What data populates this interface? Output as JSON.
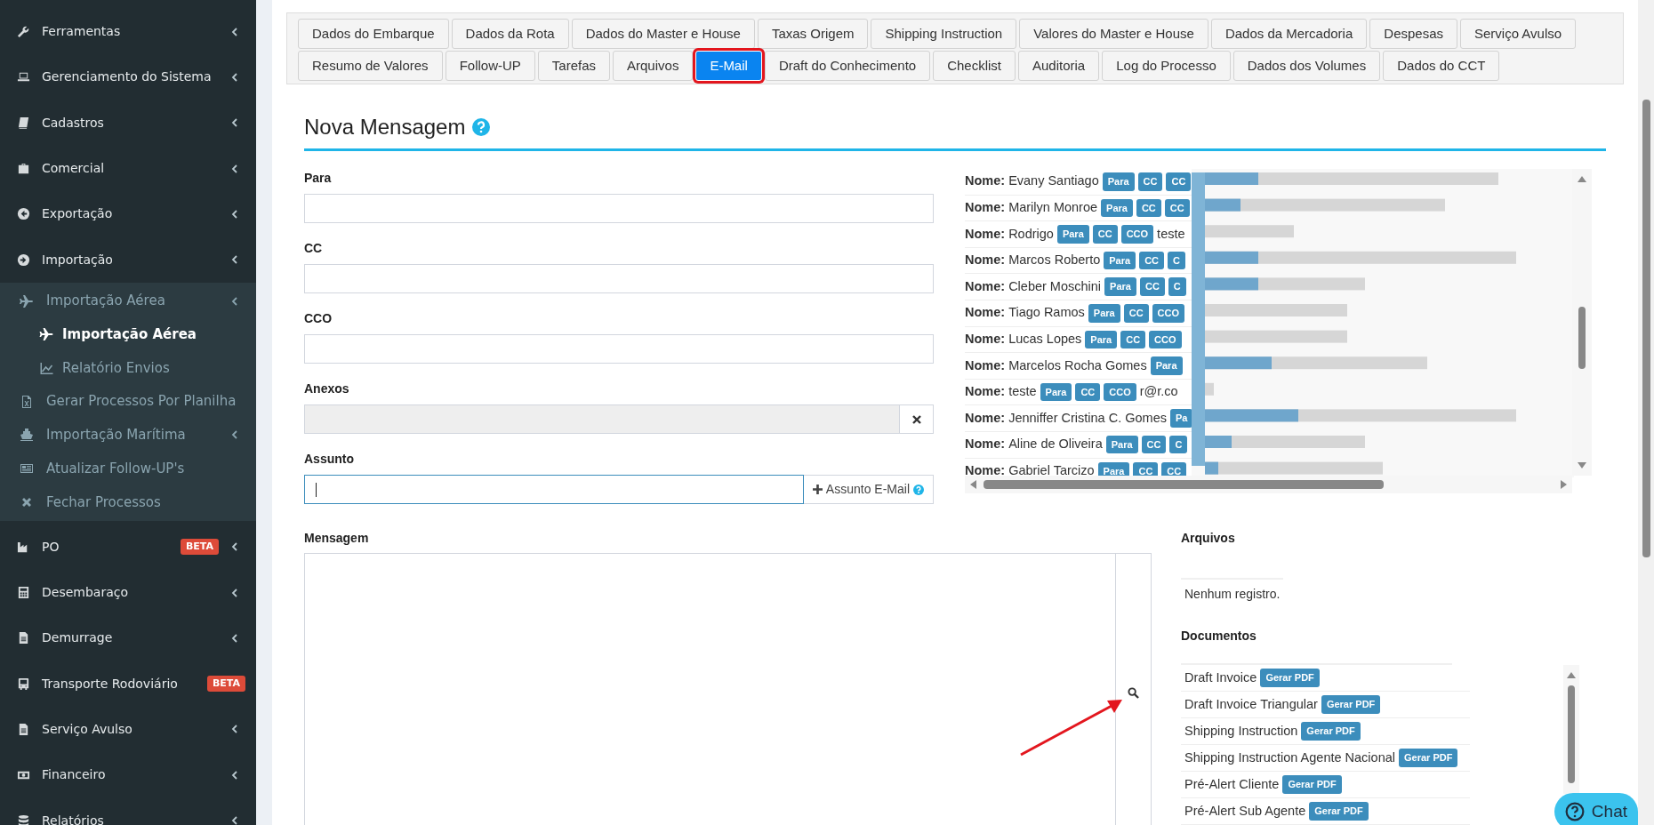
{
  "sidebar": {
    "items": [
      {
        "label": "Ferramentas",
        "caret": true
      },
      {
        "label": "Gerenciamento do Sistema",
        "caret": true
      },
      {
        "label": "Cadastros",
        "caret": true
      },
      {
        "label": "Comercial",
        "caret": true
      },
      {
        "label": "Exportação",
        "caret": true
      },
      {
        "label": "Importação",
        "caret": true,
        "expanded": true,
        "children": [
          {
            "label": "Importação Aérea",
            "caret": true,
            "selected": false,
            "children": [
              {
                "label": "Importação Aérea",
                "selected": true
              },
              {
                "label": "Relatório Envios",
                "selected": false
              }
            ]
          },
          {
            "label": "Gerar Processos Por Planilha",
            "caret": false,
            "selected": false
          },
          {
            "label": "Importação Marítima",
            "caret": true,
            "selected": false
          },
          {
            "label": "Atualizar Follow-UP's",
            "caret": false,
            "selected": false
          },
          {
            "label": "Fechar Processos",
            "caret": false,
            "selected": false
          }
        ]
      },
      {
        "label": "PO",
        "caret": true,
        "badge": "BETA"
      },
      {
        "label": "Desembaraço",
        "caret": true
      },
      {
        "label": "Demurrage",
        "caret": true
      },
      {
        "label": "Transporte Rodoviário",
        "caret": false,
        "badge": "BETA"
      },
      {
        "label": "Serviço Avulso",
        "caret": true
      },
      {
        "label": "Financeiro",
        "caret": true
      },
      {
        "label": "Relatórios",
        "caret": true
      }
    ]
  },
  "tab_rows": [
    [
      {
        "label": "Dados do Embarque",
        "selected": false
      },
      {
        "label": "Dados da Rota",
        "selected": false
      },
      {
        "label": "Dados do Master e House",
        "selected": false
      },
      {
        "label": "Taxas Origem",
        "selected": false
      },
      {
        "label": "Shipping Instruction",
        "selected": false
      },
      {
        "label": "Valores do Master e House",
        "selected": false
      },
      {
        "label": "Dados da Mercadoria",
        "selected": false
      },
      {
        "label": "Despesas",
        "selected": false
      },
      {
        "label": "Serviço Avulso",
        "selected": false
      }
    ],
    [
      {
        "label": "Resumo de Valores",
        "selected": false
      },
      {
        "label": "Follow-UP",
        "selected": false
      },
      {
        "label": "Tarefas",
        "selected": false
      },
      {
        "label": "Arquivos",
        "selected": false
      },
      {
        "label": "E-Mail",
        "selected": true
      },
      {
        "label": "Draft do Conhecimento",
        "selected": false
      },
      {
        "label": "Checklist",
        "selected": false
      },
      {
        "label": "Auditoria",
        "selected": false
      },
      {
        "label": "Log do Processo",
        "selected": false
      },
      {
        "label": "Dados dos Volumes",
        "selected": false
      },
      {
        "label": "Dados do CCT",
        "selected": false
      }
    ]
  ],
  "title": "Nova Mensagem",
  "fields": [
    {
      "kind": "text",
      "label": "Para"
    },
    {
      "kind": "text",
      "label": "CC"
    },
    {
      "kind": "text",
      "label": "CCO"
    },
    {
      "kind": "attachment",
      "label": "Anexos"
    },
    {
      "kind": "subject",
      "label": "Assunto",
      "focused": true,
      "addon": "Assunto E-Mail"
    }
  ],
  "contacts": {
    "rows": [
      {
        "label": "Nome:",
        "name": "Evany Santiago",
        "badges": [
          "Para",
          "CC",
          "CC"
        ]
      },
      {
        "label": "Nome:",
        "name": "Marilyn Monroe",
        "badges": [
          "Para",
          "CC",
          "CC"
        ]
      },
      {
        "label": "Nome:",
        "name": "Rodrigo",
        "badges": [
          "Para",
          "CC",
          "CCO"
        ],
        "email": "teste"
      },
      {
        "label": "Nome:",
        "name": "Marcos Roberto",
        "badges": [
          "Para",
          "CC",
          "C"
        ]
      },
      {
        "label": "Nome:",
        "name": "Cleber Moschini",
        "badges": [
          "Para",
          "CC",
          "C"
        ]
      },
      {
        "label": "Nome:",
        "name": "Tiago Ramos",
        "badges": [
          "Para",
          "CC",
          "CCO"
        ]
      },
      {
        "label": "Nome:",
        "name": "Lucas Lopes",
        "badges": [
          "Para",
          "CC",
          "CCO"
        ]
      },
      {
        "label": "Nome:",
        "name": "Marcelos Rocha Gomes",
        "badges": [
          "Para"
        ]
      },
      {
        "label": "Nome:",
        "name": "teste",
        "badges": [
          "Para",
          "CC",
          "CCO"
        ],
        "email": "r@r.co"
      },
      {
        "label": "Nome:",
        "name": "Jenniffer Cristina C. Gomes",
        "badges": [
          "Pa"
        ]
      },
      {
        "label": "Nome:",
        "name": "Aline de Oliveira",
        "badges": [
          "Para",
          "CC",
          "C"
        ]
      },
      {
        "label": "Nome:",
        "name": "Gabriel Tarcizo",
        "badges": [
          "Para",
          "CC",
          "CC"
        ]
      }
    ]
  },
  "message": {
    "label": "Mensagem"
  },
  "files": {
    "title": "Arquivos",
    "empty": "Nenhum registro."
  },
  "documents": {
    "title": "Documentos",
    "rows": [
      {
        "name": "Draft Invoice",
        "action": "Gerar PDF"
      },
      {
        "name": "Draft Invoice Triangular",
        "action": "Gerar PDF"
      },
      {
        "name": "Shipping Instruction",
        "action": "Gerar PDF"
      },
      {
        "name": "Shipping Instruction Agente Nacional",
        "action": "Gerar PDF"
      },
      {
        "name": "Pré-Alert Cliente",
        "action": "Gerar PDF"
      },
      {
        "name": "Pré-Alert Sub Agente",
        "action": "Gerar PDF"
      }
    ]
  },
  "chat": {
    "label": "Chat"
  }
}
